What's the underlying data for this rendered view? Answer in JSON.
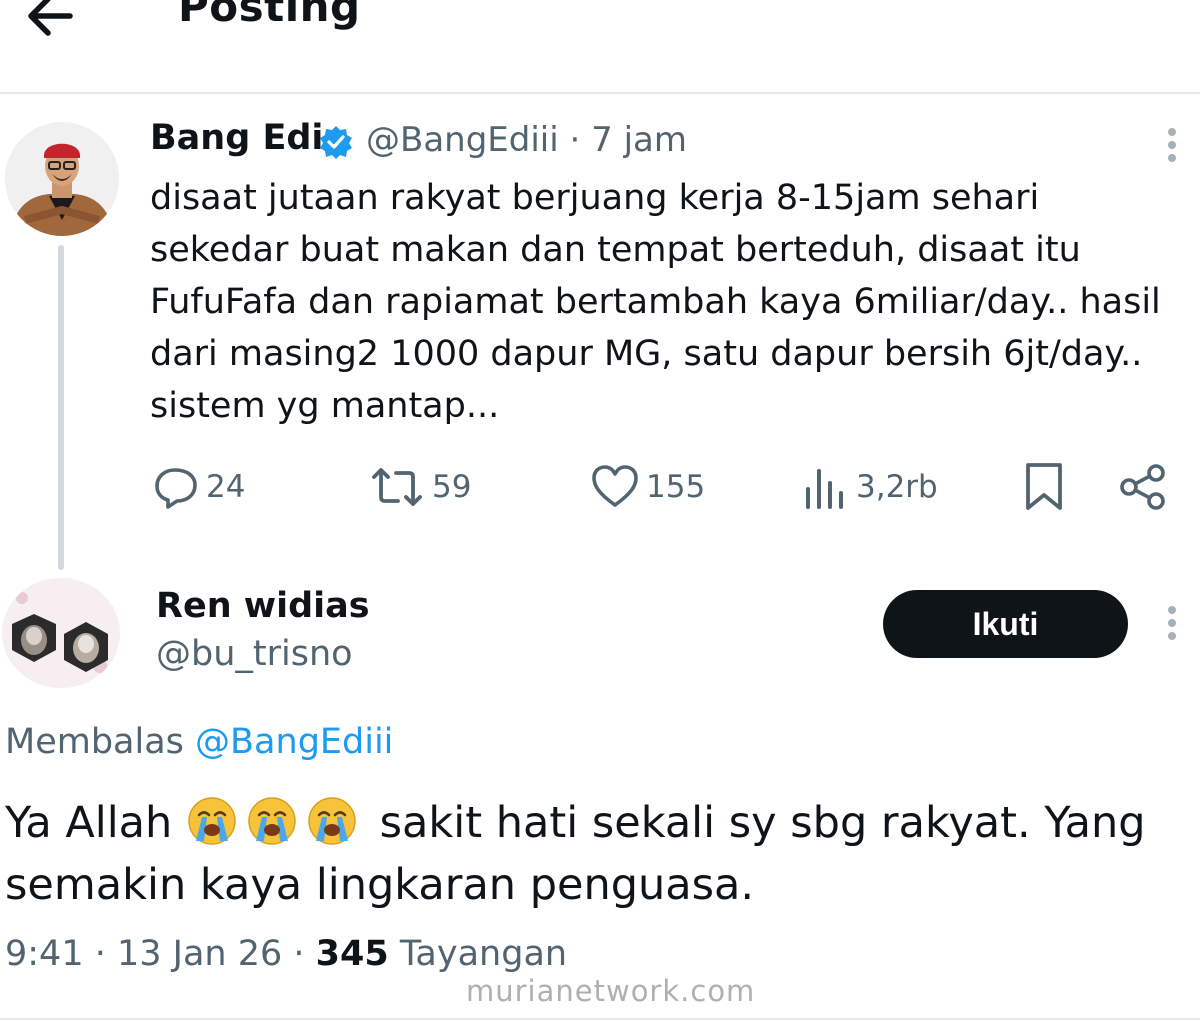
{
  "header": {
    "title": "Posting",
    "back_icon": "arrow-left-icon"
  },
  "tweet": {
    "author_name": "Bang Edi",
    "verified_icon": "verified-badge-icon",
    "handle": "@BangEdiii",
    "time": "· 7 jam",
    "text": "disaat jutaan rakyat berjuang kerja 8-15jam sehari sekedar buat makan dan tempat berteduh, disaat itu FufuFafa dan rapiamat bertambah kaya 6miliar/day.. hasil dari masing2 1000 dapur MG, satu dapur bersih 6jt/day.. sistem yg mantap...",
    "actions": {
      "replies": "24",
      "reposts": "59",
      "likes": "155",
      "views": "3,2rb"
    }
  },
  "reply": {
    "author_name": "Ren widias",
    "handle": "@bu_trisno",
    "follow_label": "Ikuti",
    "replying_prefix": "Membalas",
    "replying_to": "@BangEdiii",
    "text_before": "Ya Allah",
    "emoji_name": "loudly-crying-face",
    "emoji_count": 3,
    "text_after": "sakit hati sekali sy sbg rakyat. Yang semakin kaya lingkaran penguasa.",
    "time": "9:41 · 13 Jan 26 ·",
    "views_count": "345",
    "views_label": "Tayangan"
  },
  "watermark": "murianetwork.com",
  "colors": {
    "text": "#0f1419",
    "secondary": "#536471",
    "link": "#1d9bf0",
    "verified": "#1d9bf0",
    "button_bg": "#0f1419"
  }
}
